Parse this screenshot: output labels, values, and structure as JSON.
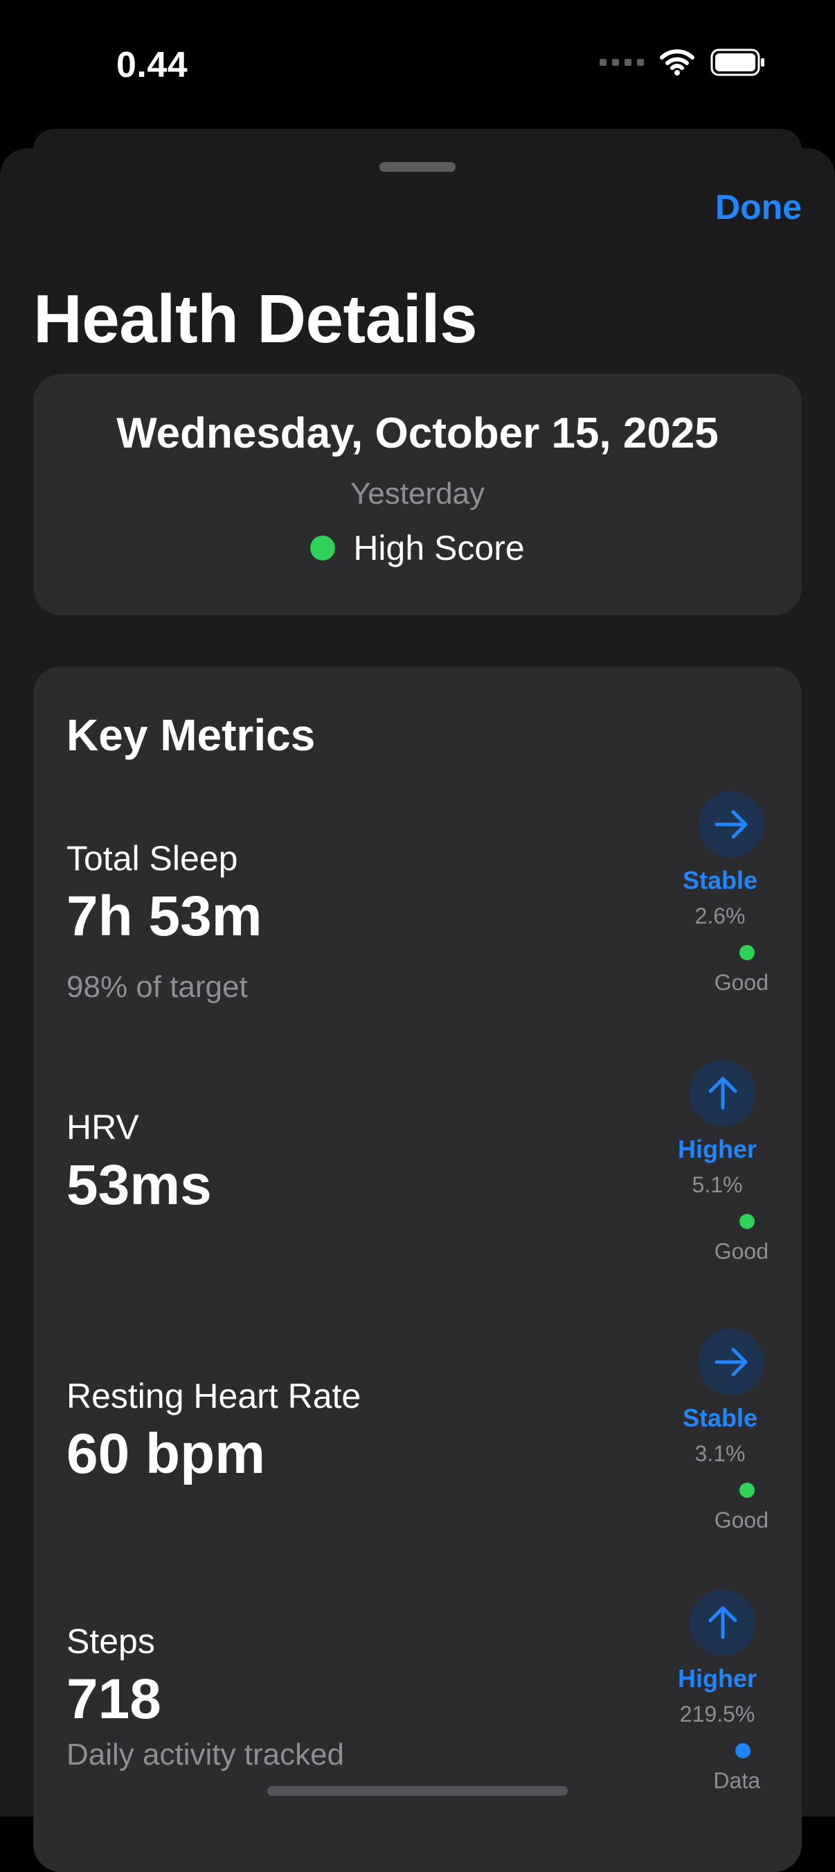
{
  "status": {
    "time": "0.44"
  },
  "sheet": {
    "done_label": "Done",
    "title": "Health Details"
  },
  "date_card": {
    "date": "Wednesday, October 15, 2025",
    "relative": "Yesterday",
    "score_label": "High Score"
  },
  "metrics": {
    "title": "Key Metrics",
    "items": [
      {
        "label": "Total Sleep",
        "value": "7h 53m",
        "sub": "98% of target",
        "trend": "Stable",
        "pct": "2.6%",
        "quality": "Good"
      },
      {
        "label": "HRV",
        "value": "53ms",
        "sub": "",
        "trend": "Higher",
        "pct": "5.1%",
        "quality": "Good"
      },
      {
        "label": "Resting Heart Rate",
        "value": "60 bpm",
        "sub": "",
        "trend": "Stable",
        "pct": "3.1%",
        "quality": "Good"
      },
      {
        "label": "Steps",
        "value": "718",
        "sub": "Daily activity tracked",
        "trend": "Higher",
        "pct": "219.5%",
        "quality": "Data"
      }
    ]
  },
  "colors": {
    "accent": "#1f86ff",
    "good": "#30d158",
    "data": "#1f86ff"
  }
}
